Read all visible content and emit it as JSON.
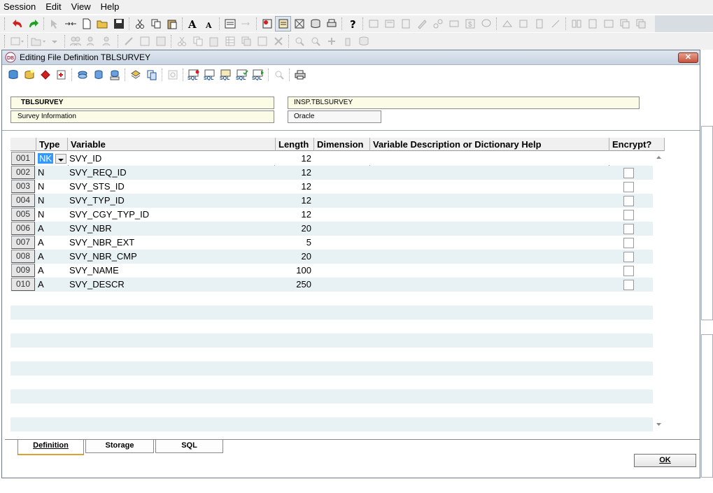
{
  "menu": [
    "Session",
    "Edit",
    "View",
    "Help"
  ],
  "window": {
    "title": "Editing File Definition TBLSURVEY",
    "close_label": "✕"
  },
  "header": {
    "table_name": "TBLSURVEY",
    "description": "Survey Information",
    "qualified_name": "INSP.TBLSURVEY",
    "dbms": "Oracle"
  },
  "grid": {
    "columns": [
      "Type",
      "Variable",
      "Length",
      "Dimension",
      "Variable Description or Dictionary Help",
      "Encrypt?"
    ],
    "rows": [
      {
        "num": "001",
        "type": "NK",
        "variable": "SVY_ID",
        "length": "12",
        "encrypt": false
      },
      {
        "num": "002",
        "type": "N",
        "variable": "SVY_REQ_ID",
        "length": "12",
        "encrypt": false
      },
      {
        "num": "003",
        "type": "N",
        "variable": "SVY_STS_ID",
        "length": "12",
        "encrypt": false
      },
      {
        "num": "004",
        "type": "N",
        "variable": "SVY_TYP_ID",
        "length": "12",
        "encrypt": false
      },
      {
        "num": "005",
        "type": "N",
        "variable": "SVY_CGY_TYP_ID",
        "length": "12",
        "encrypt": false
      },
      {
        "num": "006",
        "type": "A",
        "variable": "SVY_NBR",
        "length": "20",
        "encrypt": false
      },
      {
        "num": "007",
        "type": "A",
        "variable": "SVY_NBR_EXT",
        "length": "5",
        "encrypt": false
      },
      {
        "num": "008",
        "type": "A",
        "variable": "SVY_NBR_CMP",
        "length": "20",
        "encrypt": false
      },
      {
        "num": "009",
        "type": "A",
        "variable": "SVY_NAME",
        "length": "100",
        "encrypt": false
      },
      {
        "num": "010",
        "type": "A",
        "variable": "SVY_DESCR",
        "length": "250",
        "encrypt": false
      }
    ]
  },
  "tabs": [
    {
      "label": "Definition",
      "active": true
    },
    {
      "label": "Storage",
      "active": false
    },
    {
      "label": "SQL",
      "active": false
    }
  ],
  "buttons": {
    "ok": "OK"
  },
  "colors": {
    "accent": "#3399ff",
    "alt_row": "#e8f1f3",
    "header_box": "#fbfbe6",
    "tab_underline": "#e0a030"
  }
}
